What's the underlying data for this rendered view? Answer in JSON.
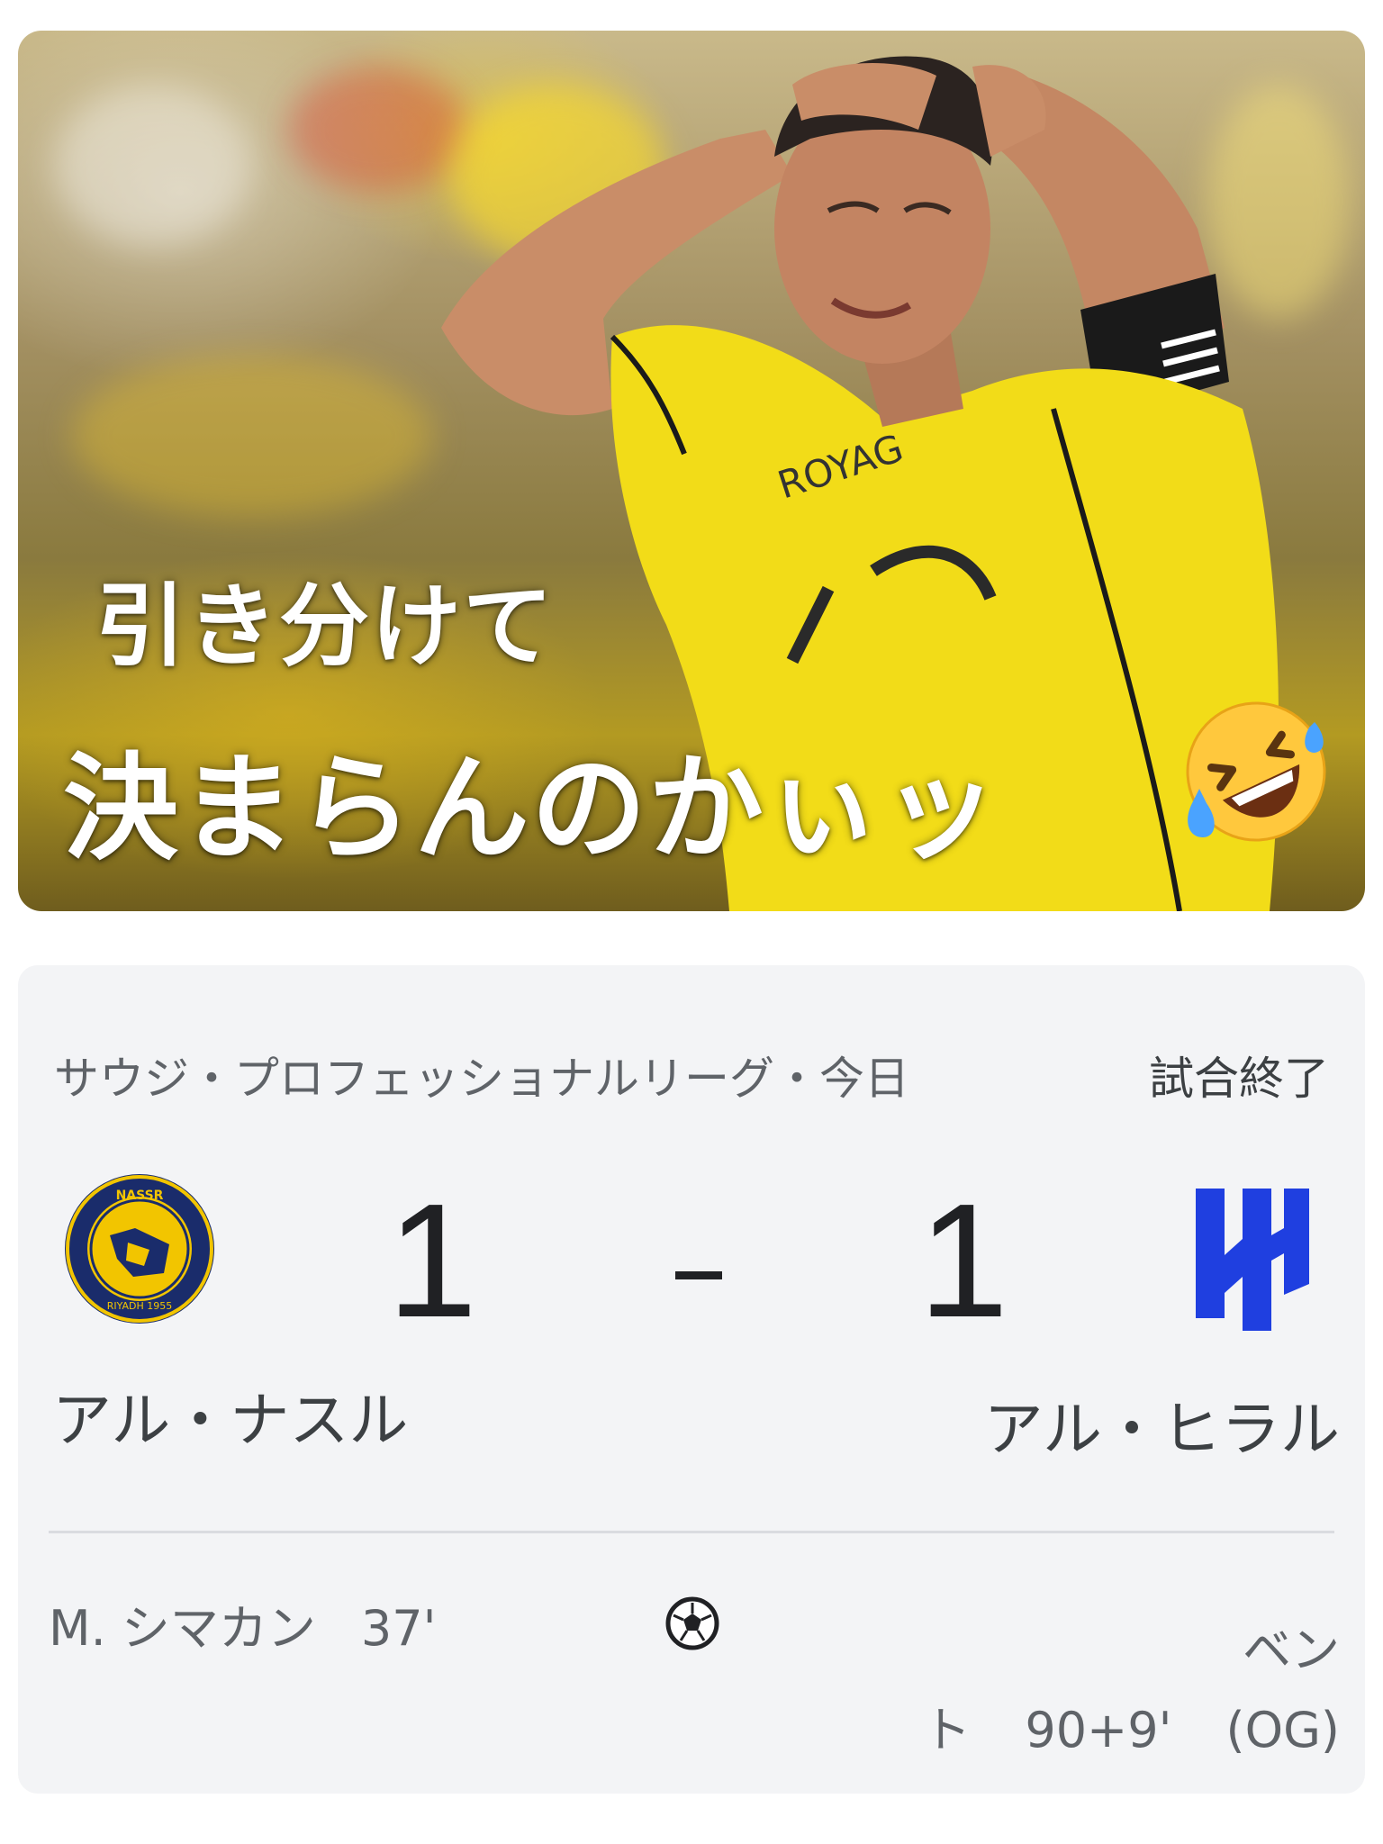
{
  "hero": {
    "line1": "引き分けて",
    "line2": "決まらんのかぃッ",
    "emoji": "rofl-emoji",
    "photo": "player-in-yellow-kit-hands-on-head",
    "jersey_color": "#f2dc18"
  },
  "match": {
    "league": "サウジ・プロフェッショナルリーグ・今日",
    "status": "試合終了",
    "home": {
      "name": "アル・ナスル",
      "score": "1",
      "logo": "al-nassr-crest",
      "logo_color": "#1a2c6b",
      "logo_accent": "#f2c500"
    },
    "separator": "-",
    "away": {
      "name": "アル・ヒラル",
      "score": "1",
      "logo": "al-hilal-crest",
      "logo_color": "#1f3fe0"
    },
    "events": {
      "icon": "soccer-ball-icon",
      "home_scorer": {
        "player": "M. シマカン",
        "minute": "37'"
      },
      "away_scorer": {
        "player_part1": "ベン",
        "player_part2": "ト",
        "minute": "90+9'",
        "note": "(OG)"
      }
    }
  }
}
